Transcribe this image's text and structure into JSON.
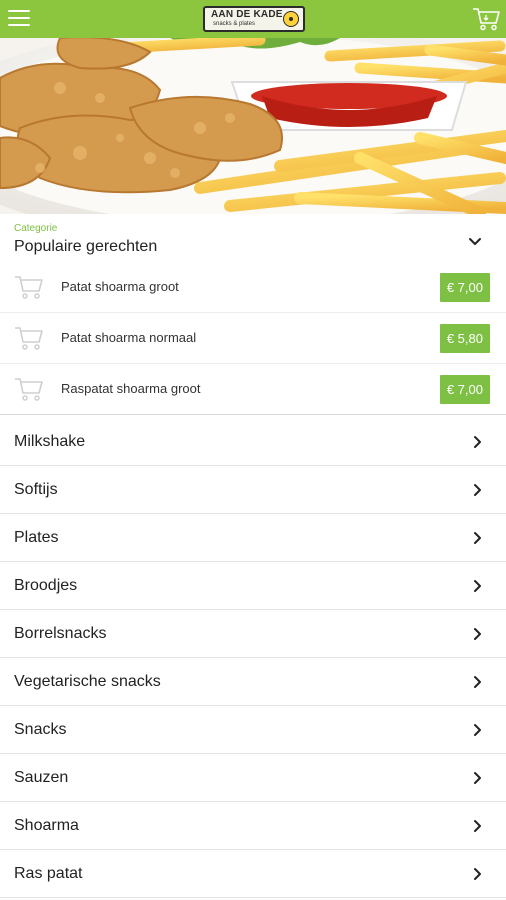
{
  "header": {
    "logo_main": "AAN DE KADE",
    "logo_sub": "snacks & plates"
  },
  "category": {
    "caption": "Categorie",
    "title": "Populaire gerechten",
    "items": [
      {
        "name": "Patat shoarma groot",
        "price": "€ 7,00"
      },
      {
        "name": "Patat shoarma normaal",
        "price": "€ 5,80"
      },
      {
        "name": "Raspatat shoarma groot",
        "price": "€ 7,00"
      }
    ]
  },
  "menu": {
    "items": [
      {
        "label": "Milkshake"
      },
      {
        "label": "Softijs"
      },
      {
        "label": "Plates"
      },
      {
        "label": "Broodjes"
      },
      {
        "label": "Borrelsnacks"
      },
      {
        "label": "Vegetarische snacks"
      },
      {
        "label": "Snacks"
      },
      {
        "label": "Sauzen"
      },
      {
        "label": "Shoarma"
      },
      {
        "label": "Ras patat"
      }
    ]
  },
  "colors": {
    "brand_green": "#8cc63f",
    "price_green": "#7dc043"
  },
  "icons": {
    "menu": "hamburger-icon",
    "cart": "cart-icon",
    "expand": "chevron-down-icon",
    "row": "chevron-right-icon"
  }
}
